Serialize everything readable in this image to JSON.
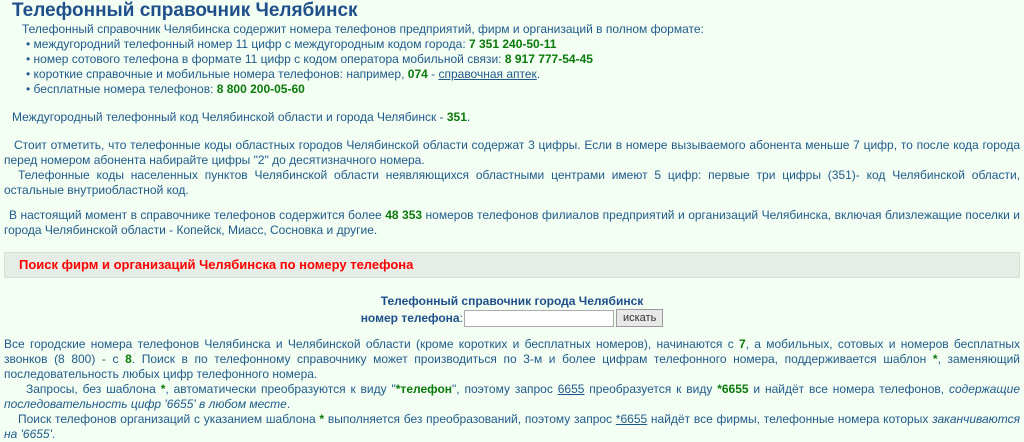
{
  "title": "Телефонный справочник Челябинск",
  "intro": {
    "lead": "Телефонный справочник Челябинска содержит номера телефонов предприятий, фирм и организаций в полном формате:",
    "items": [
      {
        "text": "междугородний телефонный номер 11 цифр с междугородным кодом города: ",
        "value": "7 351 240-50-11"
      },
      {
        "text": "номер сотового телефона в формате 11 цифр с кодом оператора мобильной связи: ",
        "value": "8 917 777-54-45"
      },
      {
        "text": "короткие справочные и мобильные номера телефонов: например, ",
        "value": "074",
        "sep": " - ",
        "link": "справочная аптек",
        "end": "."
      },
      {
        "text": "бесплатные номера телефонов: ",
        "value": "8 800 200-05-60"
      }
    ]
  },
  "p1": {
    "text": "Междугородный телефонный код Челябинской области и города Челябинск - ",
    "code": "351",
    "end": "."
  },
  "p2": "Стоит отметить, что телефонные коды областных городов Челябинской области содержат 3 цифры. Если в номере вызываемого абонента меньше 7 цифр, то после кода города перед номером абонента набирайте цифры \"2\" до десятизначного номера.",
  "p3": "Телефонные коды населенных пунктов Челябинской области неявляющихся областными центрами имеют 5 цифр: первые три цифры (351)- код Челябинской области, остальные внутриобластной код.",
  "p4": {
    "a": "В настоящий момент в справочнике телефонов содержится более ",
    "count": "48 353",
    "b": " номеров телефонов филиалов предприятий и организаций Челябинска, включая близлежащие поселки и города Челябинской области - Копейск, Миасс, Сосновка и другие."
  },
  "section_title": "Поиск фирм и организаций Челябинска по номеру телефона",
  "search": {
    "heading": "Телефонный справочник города Челябинск",
    "label": "номер телефона",
    "colon": ":",
    "value": "",
    "button": "искать"
  },
  "p5": {
    "a": "Все городские номера телефонов Челябинска и Челябинской области (кроме коротких и бесплатных номеров), начинаются с ",
    "d1": "7",
    "b": ", а мобильных, сотовых и номеров бесплатных звонков (8 800) - с ",
    "d2": "8",
    "c": ". Поиск в по телефонному справочнику может производиться по 3-м и более цифрам телефонного номера, поддерживается шаблон ",
    "star": "*",
    "d": ", заменяющий последовательность любых цифр телефонного номера."
  },
  "p6": {
    "a": "Запросы, без шаблона ",
    "star": "*",
    "b": ", автоматически преобразуются к виду \"",
    "tpl": "*телефон",
    "c": "\", поэтому запрос ",
    "q": "6655",
    "d": " преобразуется к виду ",
    "r": "*6655",
    "e": " и найдёт все номера телефонов, ",
    "em": "содержащие последовательность цифр '6655' в любом месте",
    "f": "."
  },
  "p7": {
    "a": "Поиск телефонов организаций с указанием шаблона ",
    "star": "*",
    "b": " выполняется без преобразований, поэтому запрос ",
    "q": "*6655",
    "c": " найдёт все фирмы, телефонные номера которых ",
    "em": "заканчиваются на '6655'",
    "d": "."
  }
}
